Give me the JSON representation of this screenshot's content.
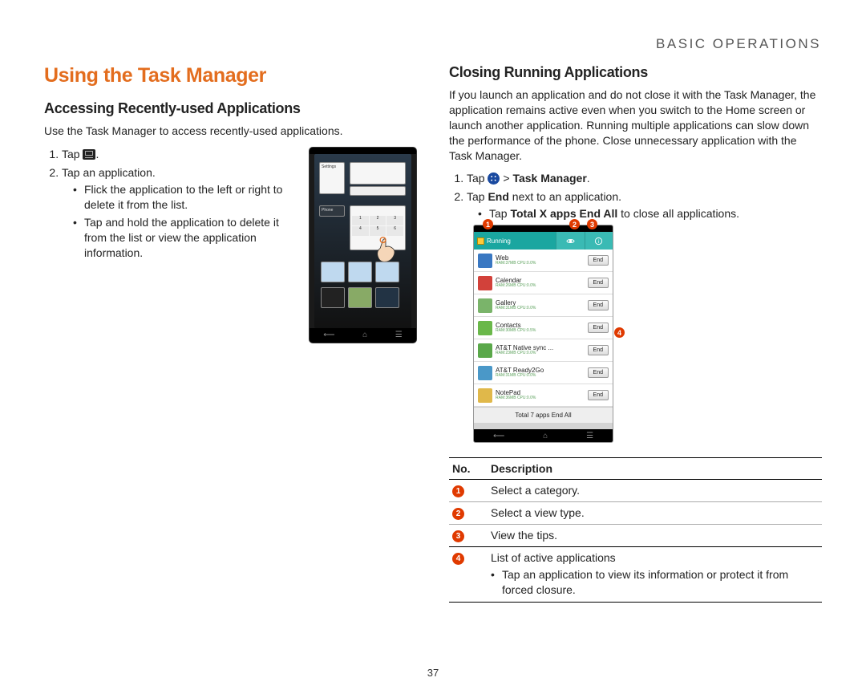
{
  "header": {
    "section": "BASIC OPERATIONS"
  },
  "page_number": "37",
  "left": {
    "h1": "Using the Task Manager",
    "h2": "Accessing Recently-used Applications",
    "intro": "Use the Task Manager to access recently-used applications.",
    "step1_pre": "Tap ",
    "step1_post": ".",
    "step2": "Tap an application.",
    "b1": "Flick the application to the left or right to delete it from the list.",
    "b2": "Tap and hold the application to delete it from the list or view the application information.",
    "shot": {
      "cards": {
        "settings": "Settings",
        "phone": "Phone"
      }
    }
  },
  "right": {
    "h2": "Closing Running Applications",
    "intro": "If you launch an application and do not close it with the Task Manager, the application remains active even when you switch to the Home screen or launch another application. Running multiple applications can slow down the performance of the phone. Close unnecessary application with the Task Manager.",
    "step1_pre": "Tap ",
    "step1_mid": " > ",
    "step1_bold": "Task Manager",
    "step1_post": ".",
    "step2_pre": "Tap ",
    "step2_bold": "End",
    "step2_post": " next to an application.",
    "sub_pre": "Tap ",
    "sub_bold": "Total X apps End All",
    "sub_post": " to close all applications.",
    "tm_shot": {
      "tab_label": "Running",
      "rows": [
        {
          "name": "Web",
          "meta": "RAM:37MB CPU:0.0%",
          "icon": "#3a78c2"
        },
        {
          "name": "Calendar",
          "meta": "RAM:26MB CPU:0.0%",
          "icon": "#d2413a"
        },
        {
          "name": "Gallery",
          "meta": "RAM:31MB CPU:0.0%",
          "icon": "#7ab46a"
        },
        {
          "name": "Contacts",
          "meta": "RAM:30MB CPU:0.5%",
          "icon": "#6ab84a"
        },
        {
          "name": "AT&T Native sync ...",
          "meta": "RAM:23MB CPU:0.0%",
          "icon": "#5aa84a"
        },
        {
          "name": "AT&T Ready2Go",
          "meta": "RAM:31MB CPU:0.0%",
          "icon": "#4a98c8"
        },
        {
          "name": "NotePad",
          "meta": "RAM:36MB CPU:0.0%",
          "icon": "#e0b84a"
        }
      ],
      "end_label": "End",
      "footer": "Total 7 apps End All"
    }
  },
  "table": {
    "head_no": "No.",
    "head_desc": "Description",
    "rows": [
      {
        "n": "1",
        "d": "Select a category."
      },
      {
        "n": "2",
        "d": "Select a view type."
      },
      {
        "n": "3",
        "d": "View the tips."
      }
    ],
    "row4_n": "4",
    "row4_line": "List of active applications",
    "row4_sub": "Tap an application to view its information or protect it from forced closure."
  }
}
